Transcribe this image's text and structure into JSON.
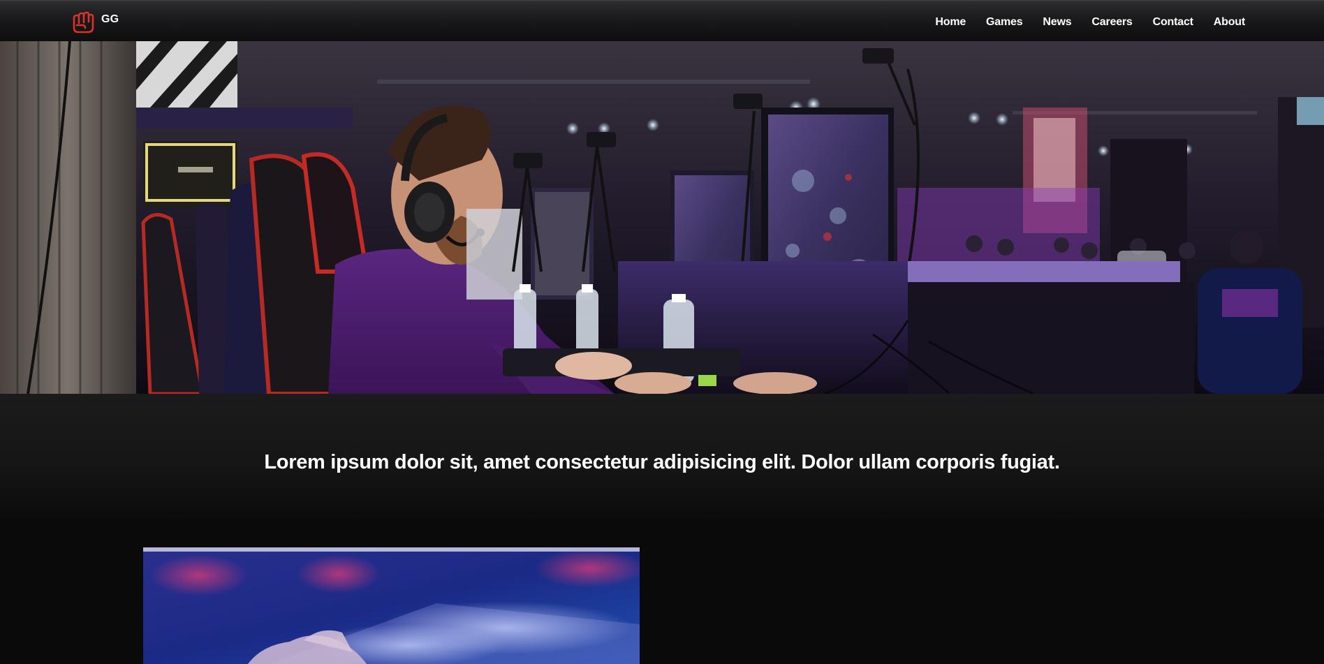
{
  "brand": {
    "logo_icon": "fist-logo-icon",
    "name": "GG",
    "accent_color": "#d8342b"
  },
  "nav": {
    "items": [
      {
        "label": "Home"
      },
      {
        "label": "Games"
      },
      {
        "label": "News"
      },
      {
        "label": "Careers"
      },
      {
        "label": "Contact"
      },
      {
        "label": "About"
      }
    ]
  },
  "hero": {
    "image": "esports-gamer-hero-photo"
  },
  "main": {
    "tagline": "Lorem ipsum dolor sit, amet consectetur adipisicing elit. Dolor ullam corporis fugiat."
  },
  "feature": {
    "image": "keyboard-hands-photo"
  },
  "colors": {
    "page_background": "#0a0a0b",
    "navbar_background": "#1a1a1c",
    "text": "#ffffff"
  }
}
